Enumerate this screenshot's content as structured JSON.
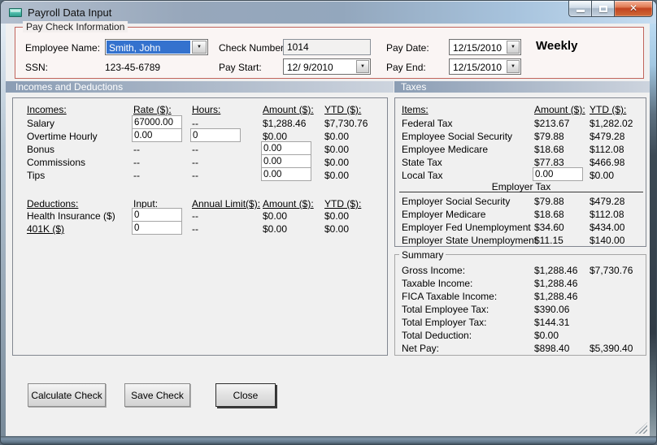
{
  "window": {
    "title": "Payroll Data Input"
  },
  "titlebar_icons": {
    "app_icon": "form-window-icon",
    "minimize": "minimize-bar",
    "maximize": "restore-square",
    "close": "✕"
  },
  "paycheck": {
    "group_label": "Pay Check Information",
    "employee_name": {
      "label": "Employee Name:",
      "value": "Smith, John"
    },
    "ssn": {
      "label": "SSN:",
      "value": "123-45-6789"
    },
    "check_number": {
      "label": "Check Number:",
      "value": "1014"
    },
    "pay_start": {
      "label": "Pay Start:",
      "value": "12/ 9/2010"
    },
    "pay_date": {
      "label": "Pay Date:",
      "value": "12/15/2010"
    },
    "pay_end": {
      "label": "Pay End:",
      "value": "12/15/2010"
    },
    "frequency": "Weekly",
    "dropdown_arrow": "▼"
  },
  "incomes_deductions": {
    "section_header": "Incomes and Deductions",
    "income_headers": {
      "item": "Incomes:",
      "rate": "Rate ($):",
      "hours": "Hours:",
      "amount": "Amount ($):",
      "ytd": "YTD ($):"
    },
    "income_rows": [
      {
        "label": "Salary",
        "rate": "67000.00",
        "hours": "--",
        "amount": "$1,288.46",
        "ytd": "$7,730.76"
      },
      {
        "label": "Overtime Hourly",
        "rate": "0.00",
        "hours": "0",
        "amount": "$0.00",
        "ytd": "$0.00"
      },
      {
        "label": "Bonus",
        "rate": "--",
        "hours": "--",
        "amount": "0.00",
        "ytd": "$0.00"
      },
      {
        "label": "Commissions",
        "rate": "--",
        "hours": "--",
        "amount": "0.00",
        "ytd": "$0.00"
      },
      {
        "label": "Tips",
        "rate": "--",
        "hours": "--",
        "amount": "0.00",
        "ytd": "$0.00"
      }
    ],
    "deduction_headers": {
      "item": "Deductions:",
      "input": "Input:",
      "limit": "Annual Limit($):",
      "amount": "Amount ($):",
      "ytd": "YTD ($):"
    },
    "deduction_rows": [
      {
        "label": "Health Insurance  ($)",
        "input": "0",
        "limit": "--",
        "amount": "$0.00",
        "ytd": "$0.00"
      },
      {
        "label": "401K  ($)",
        "input": "0",
        "limit": "--",
        "amount": "$0.00",
        "ytd": "$0.00"
      }
    ]
  },
  "taxes": {
    "section_header": "Taxes",
    "headers": {
      "item": "Items:",
      "amount": "Amount ($):",
      "ytd": "YTD ($):"
    },
    "employee_rows": [
      {
        "label": "Federal Tax",
        "amount": "$213.67",
        "ytd": "$1,282.02"
      },
      {
        "label": "Employee Social Security",
        "amount": "$79.88",
        "ytd": "$479.28"
      },
      {
        "label": "Employee Medicare",
        "amount": "$18.68",
        "ytd": "$112.08"
      },
      {
        "label": "State Tax",
        "amount": "$77.83",
        "ytd": "$466.98"
      }
    ],
    "local_tax": {
      "label": "Local Tax",
      "amount": "0.00",
      "ytd": "$0.00"
    },
    "employer_group_label": "Employer Tax",
    "employer_rows": [
      {
        "label": "Employer Social Security",
        "amount": "$79.88",
        "ytd": "$479.28"
      },
      {
        "label": "Employer Medicare",
        "amount": "$18.68",
        "ytd": "$112.08"
      },
      {
        "label": "Employer Fed Unemployment",
        "amount": "$34.60",
        "ytd": "$434.00"
      },
      {
        "label": "Employer State Unemployment",
        "amount": "$11.15",
        "ytd": "$140.00"
      }
    ]
  },
  "summary": {
    "group_label": "Summary",
    "rows": [
      {
        "label": "Gross Income:",
        "amount": "$1,288.46",
        "ytd": "$7,730.76"
      },
      {
        "label": "Taxable Income:",
        "amount": "$1,288.46",
        "ytd": ""
      },
      {
        "label": "FICA Taxable Income:",
        "amount": "$1,288.46",
        "ytd": ""
      },
      {
        "label": "Total Employee Tax:",
        "amount": "$390.06",
        "ytd": ""
      },
      {
        "label": "Total Employer Tax:",
        "amount": "$144.31",
        "ytd": ""
      },
      {
        "label": "Total Deduction:",
        "amount": "$0.00",
        "ytd": ""
      },
      {
        "label": "Net Pay:",
        "amount": "$898.40",
        "ytd": "$5,390.40"
      }
    ]
  },
  "buttons": {
    "calculate": "Calculate Check",
    "save": "Save Check",
    "close": "Close"
  },
  "colors": {
    "selection_blue": "#3472ce",
    "section_bar_start": "#8b9db4",
    "section_bar_end": "#cdd4de",
    "group_border_red": "#c0645c",
    "close_button_red": "#c24421",
    "client_bg": "#f0f0f0"
  }
}
